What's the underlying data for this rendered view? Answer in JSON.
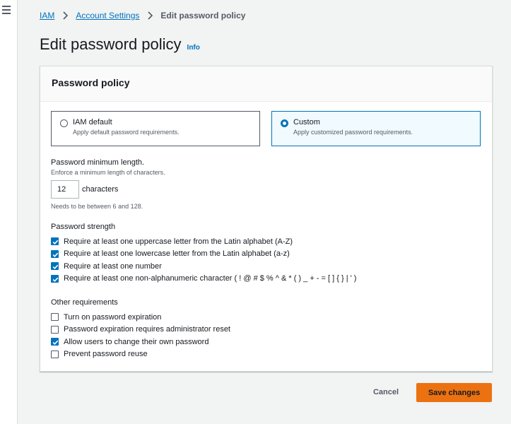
{
  "breadcrumb": {
    "items": [
      "IAM",
      "Account Settings"
    ],
    "current": "Edit password policy"
  },
  "page": {
    "title": "Edit password policy",
    "info": "Info"
  },
  "panel": {
    "header": "Password policy",
    "options": [
      {
        "title": "IAM default",
        "description": "Apply default password requirements.",
        "selected": false
      },
      {
        "title": "Custom",
        "description": "Apply customized password requirements.",
        "selected": true
      }
    ],
    "min_length": {
      "label": "Password minimum length.",
      "description": "Enforce a minimum length of characters.",
      "value": "12",
      "suffix": "characters",
      "hint": "Needs to be between 6 and 128."
    },
    "strength": {
      "title": "Password strength",
      "items": [
        {
          "label": "Require at least one uppercase letter from the Latin alphabet (A-Z)",
          "checked": true
        },
        {
          "label": "Require at least one lowercase letter from the Latin alphabet (a-z)",
          "checked": true
        },
        {
          "label": "Require at least one number",
          "checked": true
        },
        {
          "label": "Require at least one non-alphanumeric character ( ! @ # $ % ^ & * ( ) _ + - = [ ] { } | ' )",
          "checked": true
        }
      ]
    },
    "other": {
      "title": "Other requirements",
      "items": [
        {
          "label": "Turn on password expiration",
          "checked": false
        },
        {
          "label": "Password expiration requires administrator reset",
          "checked": false
        },
        {
          "label": "Allow users to change their own password",
          "checked": true
        },
        {
          "label": "Prevent password reuse",
          "checked": false
        }
      ]
    }
  },
  "actions": {
    "cancel": "Cancel",
    "save": "Save changes"
  },
  "colors": {
    "accent": "#0073bb",
    "primary_button": "#ec7211"
  }
}
